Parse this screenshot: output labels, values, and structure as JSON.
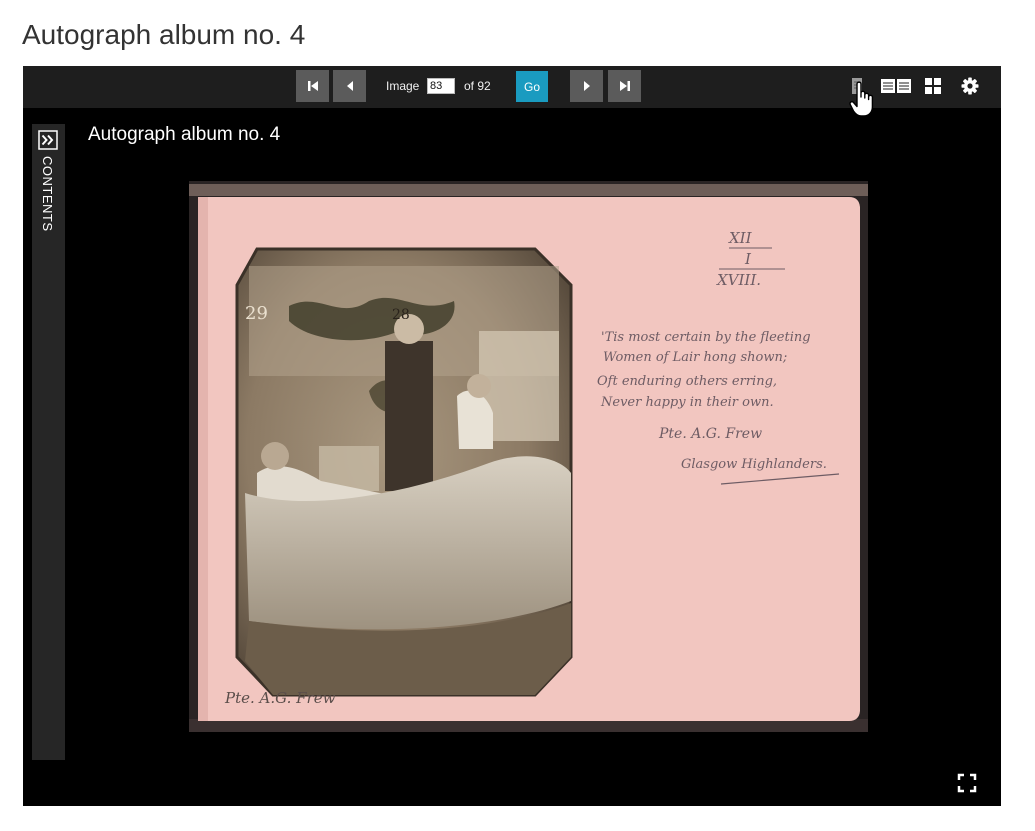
{
  "page": {
    "heading": "Autograph album no. 4"
  },
  "viewer": {
    "title": "Autograph album no. 4",
    "toolbar": {
      "image_label": "Image",
      "current_image": "83",
      "of_label": "of 92",
      "go_label": "Go",
      "icons": [
        "first-page-icon",
        "previous-page-icon",
        "next-page-icon",
        "last-page-icon",
        "single-page-view-icon",
        "two-page-view-icon",
        "gallery-view-icon",
        "settings-gear-icon"
      ]
    },
    "sidebar": {
      "label": "CONTENTS",
      "toggle_icon": "expand-chevrons-icon"
    },
    "fullscreen_icon": "fullscreen-icon",
    "scan": {
      "photo_numbers": [
        "29",
        "28"
      ],
      "roman_numerals": [
        "XII",
        "I",
        "XVIII."
      ],
      "handwritten_lines": [
        "'Tis most certain by the fleeting",
        "Women of Lair hong shown;",
        "Oft enduring others erring,",
        "Never happy in their own.",
        "Pte. A.G. Frew",
        "Glasgow Highlanders."
      ],
      "photo_signature": "Pte. A.G. Frew"
    }
  },
  "colors": {
    "page_background": "#ffffff",
    "viewer_background": "#000000",
    "toolbar_background": "#1e1e1e",
    "nav_button": "#5b5b5b",
    "go_button": "#1a9bc0",
    "album_page": "#f2c6c0",
    "photo_sepia": "#8f7c66"
  }
}
